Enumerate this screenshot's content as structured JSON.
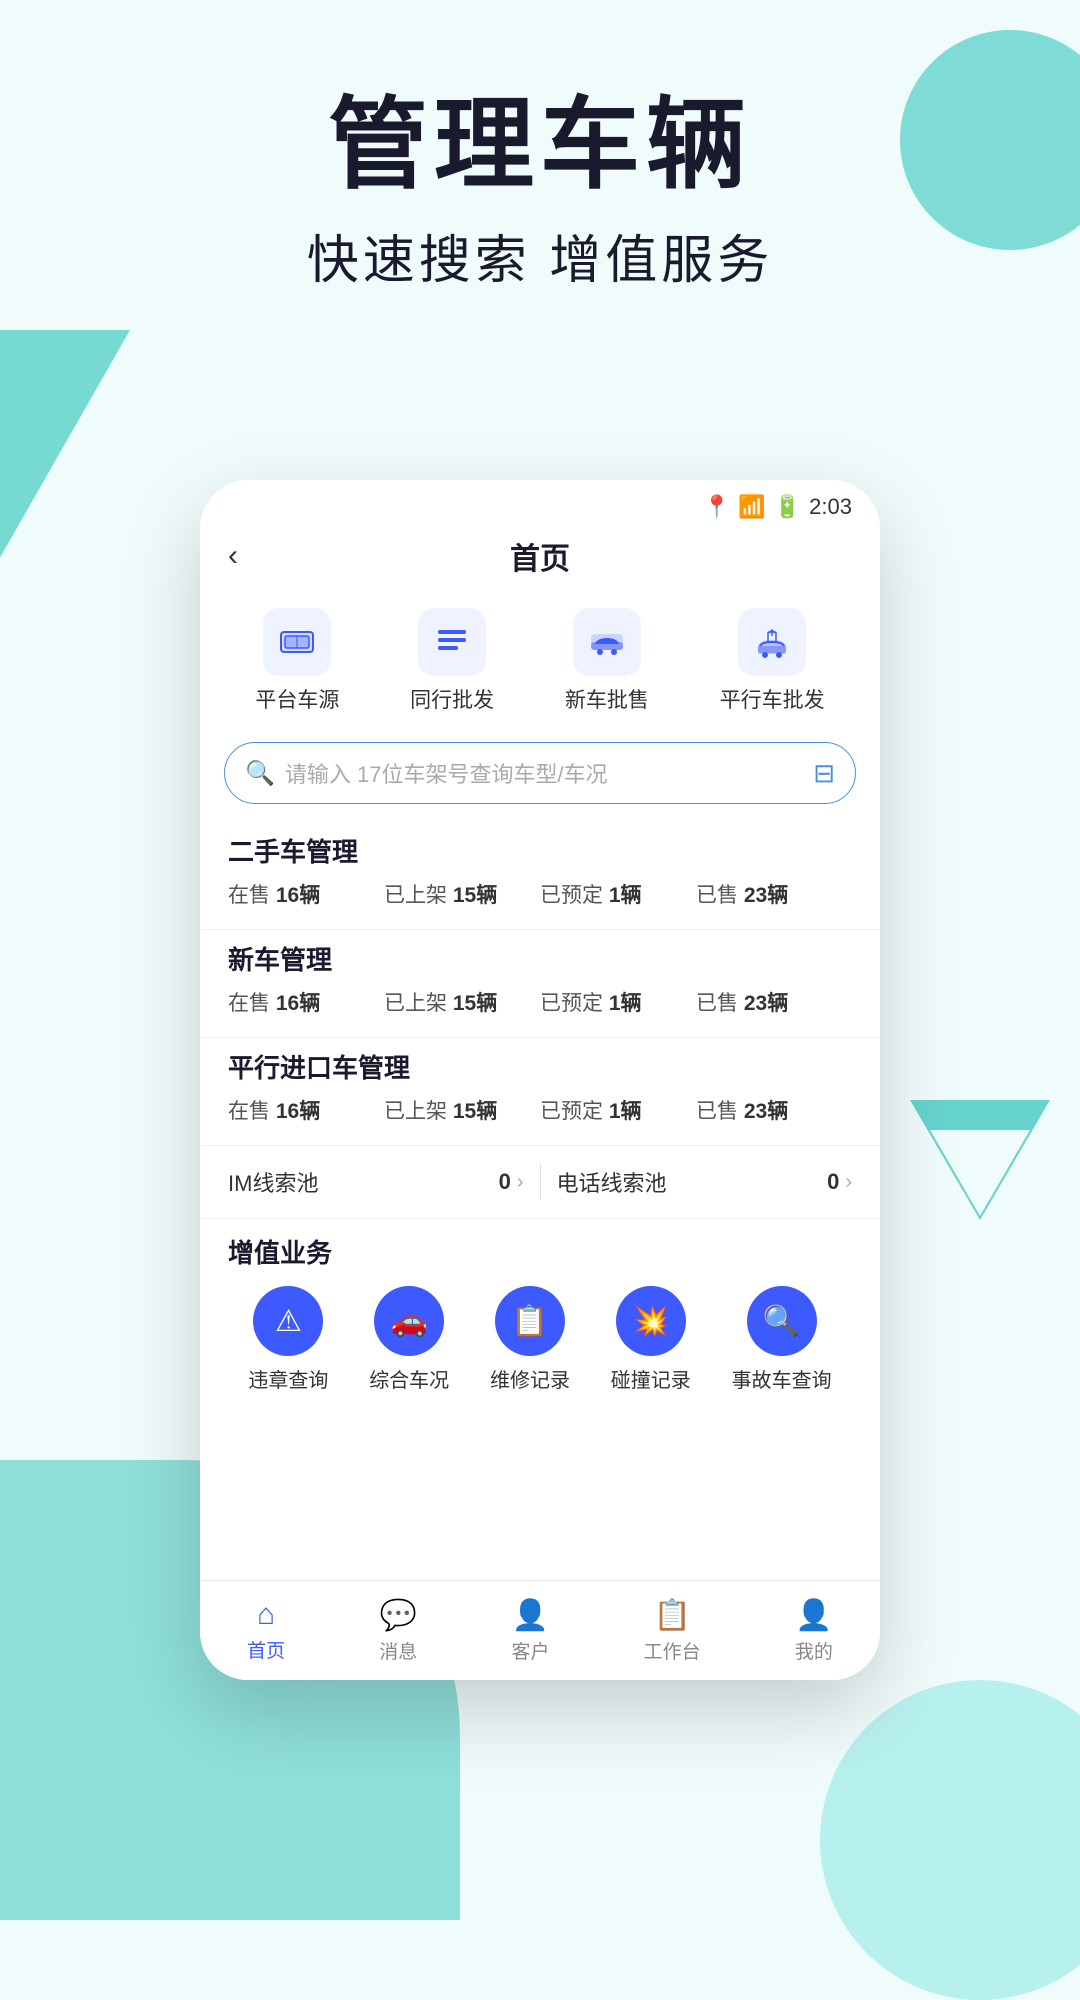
{
  "hero": {
    "title": "管理车辆",
    "subtitle": "快速搜索 增值服务"
  },
  "phone": {
    "statusBar": {
      "time": "2:03"
    },
    "header": {
      "backLabel": "‹",
      "title": "首页"
    },
    "quickNav": [
      {
        "id": "platform",
        "label": "平台车源",
        "icon": "monitor"
      },
      {
        "id": "peer",
        "label": "同行批发",
        "icon": "list"
      },
      {
        "id": "newcar",
        "label": "新车批售",
        "icon": "car-front"
      },
      {
        "id": "import",
        "label": "平行车批发",
        "icon": "car-dealer"
      }
    ],
    "searchBar": {
      "placeholder": "请输入 17位车架号查询车型/车况"
    },
    "sections": [
      {
        "id": "used",
        "title": "二手车管理",
        "stats": [
          {
            "label": "在售",
            "value": "16辆"
          },
          {
            "label": "已上架",
            "value": "15辆"
          },
          {
            "label": "已预定",
            "value": "1辆"
          },
          {
            "label": "已售",
            "value": "23辆"
          }
        ]
      },
      {
        "id": "new",
        "title": "新车管理",
        "stats": [
          {
            "label": "在售",
            "value": "16辆"
          },
          {
            "label": "已上架",
            "value": "15辆"
          },
          {
            "label": "已预定",
            "value": "1辆"
          },
          {
            "label": "已售",
            "value": "23辆"
          }
        ]
      },
      {
        "id": "parallel",
        "title": "平行进口车管理",
        "stats": [
          {
            "label": "在售",
            "value": "16辆"
          },
          {
            "label": "已上架",
            "value": "15辆"
          },
          {
            "label": "已预定",
            "value": "1辆"
          },
          {
            "label": "已售",
            "value": "23辆"
          }
        ]
      }
    ],
    "leadPool": {
      "im": {
        "label": "IM线索池",
        "value": "0"
      },
      "phone": {
        "label": "电话线索池",
        "value": "0"
      }
    },
    "valuedAdded": {
      "title": "增值业务",
      "items": [
        {
          "id": "violation",
          "label": "违章查询",
          "icon": "⚠"
        },
        {
          "id": "condition",
          "label": "综合车况",
          "icon": "🚗"
        },
        {
          "id": "maintenance",
          "label": "维修记录",
          "icon": "📋"
        },
        {
          "id": "collision",
          "label": "碰撞记录",
          "icon": "💥"
        },
        {
          "id": "accident",
          "label": "事故车查询",
          "icon": "🔍"
        }
      ]
    },
    "tabBar": {
      "items": [
        {
          "id": "home",
          "label": "首页",
          "active": true,
          "icon": "⌂"
        },
        {
          "id": "message",
          "label": "消息",
          "active": false,
          "icon": "💬"
        },
        {
          "id": "customer",
          "label": "客户",
          "active": false,
          "icon": "👤"
        },
        {
          "id": "workspace",
          "label": "工作台",
          "active": false,
          "icon": "📋"
        },
        {
          "id": "mine",
          "label": "我的",
          "active": false,
          "icon": "👤"
        }
      ]
    }
  }
}
